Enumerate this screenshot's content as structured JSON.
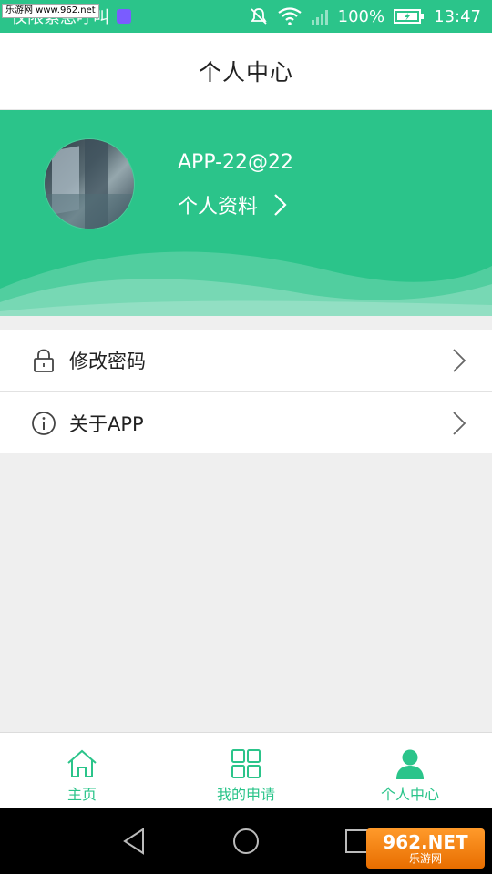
{
  "statusbar": {
    "notification_text": "仅限紧急呼叫",
    "battery": "100%",
    "time": "13:47"
  },
  "watermark": {
    "top_left": "乐游网 www.962.net",
    "bottom_right_big": "962.NET",
    "bottom_right_small": "乐游网"
  },
  "header": {
    "title": "个人中心"
  },
  "profile": {
    "username": "APP-22@22",
    "link_label": "个人资料"
  },
  "menu": {
    "items": [
      {
        "label": "修改密码",
        "icon": "lock-icon"
      },
      {
        "label": "关于APP",
        "icon": "info-icon"
      }
    ]
  },
  "bottom_nav": {
    "tabs": [
      {
        "label": "主页",
        "icon": "home-icon"
      },
      {
        "label": "我的申请",
        "icon": "grid-icon"
      },
      {
        "label": "个人中心",
        "icon": "person-icon"
      }
    ],
    "active_tab": "个人中心"
  },
  "colors": {
    "accent": "#2bc48a",
    "text": "#222222",
    "background": "#efefef"
  }
}
